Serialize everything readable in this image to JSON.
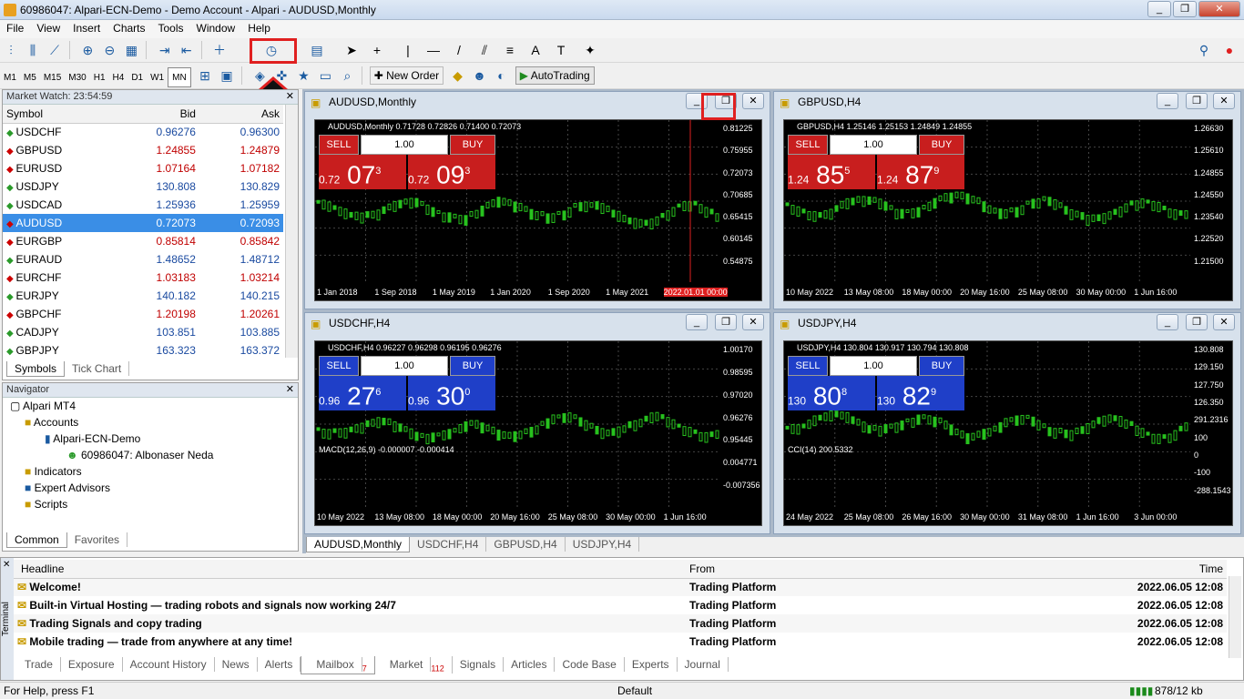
{
  "title": "60986047: Alpari-ECN-Demo - Demo Account - Alpari - AUDUSD,Monthly",
  "menu": [
    "File",
    "View",
    "Insert",
    "Charts",
    "Tools",
    "Window",
    "Help"
  ],
  "timeframes": [
    "M1",
    "M5",
    "M15",
    "M30",
    "H1",
    "H4",
    "D1",
    "W1",
    "MN"
  ],
  "toolbar": {
    "new_order": "New Order",
    "autotrading": "AutoTrading"
  },
  "market_watch": {
    "title": "Market Watch: 23:54:59",
    "cols": [
      "Symbol",
      "Bid",
      "Ask"
    ],
    "rows": [
      [
        "USDCHF",
        "0.96276",
        "0.96300",
        "up"
      ],
      [
        "GBPUSD",
        "1.24855",
        "1.24879",
        "dn"
      ],
      [
        "EURUSD",
        "1.07164",
        "1.07182",
        "dn"
      ],
      [
        "USDJPY",
        "130.808",
        "130.829",
        "up"
      ],
      [
        "USDCAD",
        "1.25936",
        "1.25959",
        "up"
      ],
      [
        "AUDUSD",
        "0.72073",
        "0.72093",
        "dn"
      ],
      [
        "EURGBP",
        "0.85814",
        "0.85842",
        "dn"
      ],
      [
        "EURAUD",
        "1.48652",
        "1.48712",
        "up"
      ],
      [
        "EURCHF",
        "1.03183",
        "1.03214",
        "dn"
      ],
      [
        "EURJPY",
        "140.182",
        "140.215",
        "up"
      ],
      [
        "GBPCHF",
        "1.20198",
        "1.20261",
        "dn"
      ],
      [
        "CADJPY",
        "103.851",
        "103.885",
        "up"
      ],
      [
        "GBPJPY",
        "163.323",
        "163.372",
        "up"
      ]
    ],
    "tabs": [
      "Symbols",
      "Tick Chart"
    ]
  },
  "navigator": {
    "title": "Navigator",
    "items": [
      "Alpari MT4",
      "Accounts",
      "Alpari-ECN-Demo",
      "60986047: Albonaser Neda",
      "Indicators",
      "Expert Advisors",
      "Scripts"
    ],
    "tabs": [
      "Common",
      "Favorites"
    ]
  },
  "charts": [
    {
      "caption": "AUDUSD,Monthly",
      "info": "AUDUSD,Monthly  0.71728 0.72826 0.71400 0.72073",
      "lot": "1.00",
      "sell_pre": "0.72",
      "sell_big": "07",
      "sell_sup": "3",
      "buy_pre": "0.72",
      "buy_big": "09",
      "buy_sup": "3",
      "yaxis": [
        "0.81225",
        "0.75955",
        "0.72073",
        "0.70685",
        "0.65415",
        "0.60145",
        "0.54875"
      ],
      "xaxis": [
        "1 Jan 2018",
        "1 Sep 2018",
        "1 May 2019",
        "1 Jan 2020",
        "1 Sep 2020",
        "1 May 2021",
        "2022.01.01 00:00"
      ]
    },
    {
      "caption": "GBPUSD,H4",
      "info": "GBPUSD,H4  1.25146 1.25153 1.24849 1.24855",
      "lot": "1.00",
      "sell_pre": "1.24",
      "sell_big": "85",
      "sell_sup": "5",
      "buy_pre": "1.24",
      "buy_big": "87",
      "buy_sup": "9",
      "yaxis": [
        "1.26630",
        "1.25610",
        "1.24855",
        "1.24550",
        "1.23540",
        "1.22520",
        "1.21500"
      ],
      "xaxis": [
        "10 May 2022",
        "13 May 08:00",
        "18 May 00:00",
        "20 May 16:00",
        "25 May 08:00",
        "30 May 00:00",
        "1 Jun 16:00"
      ]
    },
    {
      "caption": "USDCHF,H4",
      "info": "USDCHF,H4  0.96227 0.96298 0.96195 0.96276",
      "lot": "1.00",
      "sell_pre": "0.96",
      "sell_big": "27",
      "sell_sup": "6",
      "buy_pre": "0.96",
      "buy_big": "30",
      "buy_sup": "0",
      "yaxis": [
        "1.00170",
        "0.98595",
        "0.97020",
        "0.96276",
        "0.95445",
        "0.004771",
        "-0.007356"
      ],
      "macd": "MACD(12,26,9) -0.000007 -0.000414",
      "xaxis": [
        "10 May 2022",
        "13 May 08:00",
        "18 May 00:00",
        "20 May 16:00",
        "25 May 08:00",
        "30 May 00:00",
        "1 Jun 16:00"
      ]
    },
    {
      "caption": "USDJPY,H4",
      "info": "USDJPY,H4  130.804 130.917 130.794 130.808",
      "lot": "1.00",
      "sell_pre": "130",
      "sell_big": "80",
      "sell_sup": "8",
      "buy_pre": "130",
      "buy_big": "82",
      "buy_sup": "9",
      "yaxis": [
        "130.808",
        "129.150",
        "127.750",
        "126.350",
        "291.2316",
        "100",
        "0",
        "-100",
        "-288.1543"
      ],
      "cci": "CCI(14) 200.5332",
      "xaxis": [
        "24 May 2022",
        "25 May 08:00",
        "26 May 16:00",
        "30 May 00:00",
        "31 May 08:00",
        "1 Jun 16:00",
        "3 Jun 00:00"
      ]
    }
  ],
  "chart_tabs": [
    "AUDUSD,Monthly",
    "USDCHF,H4",
    "GBPUSD,H4",
    "USDJPY,H4"
  ],
  "terminal": {
    "cols": [
      "Headline",
      "From",
      "Time"
    ],
    "rows": [
      [
        "Welcome!",
        "Trading Platform",
        "2022.06.05 12:08"
      ],
      [
        "Built-in Virtual Hosting — trading robots and signals now working 24/7",
        "Trading Platform",
        "2022.06.05 12:08"
      ],
      [
        "Trading Signals and copy trading",
        "Trading Platform",
        "2022.06.05 12:08"
      ],
      [
        "Mobile trading — trade from anywhere at any time!",
        "Trading Platform",
        "2022.06.05 12:08"
      ]
    ],
    "tabs": [
      "Trade",
      "Exposure",
      "Account History",
      "News",
      "Alerts",
      "Mailbox",
      "Market",
      "Signals",
      "Articles",
      "Code Base",
      "Experts",
      "Journal"
    ],
    "mailbox_badge": "7",
    "market_badge": "112",
    "side_label": "Terminal"
  },
  "status": {
    "help": "For Help, press F1",
    "profile": "Default",
    "traffic": "878/12 kb"
  },
  "colors": {
    "sell": "#c81e1e",
    "buy_red": "#c81e1e",
    "buy_blue": "#1f3fc8",
    "bull": "#27c21e",
    "highlight": "#e02020"
  }
}
